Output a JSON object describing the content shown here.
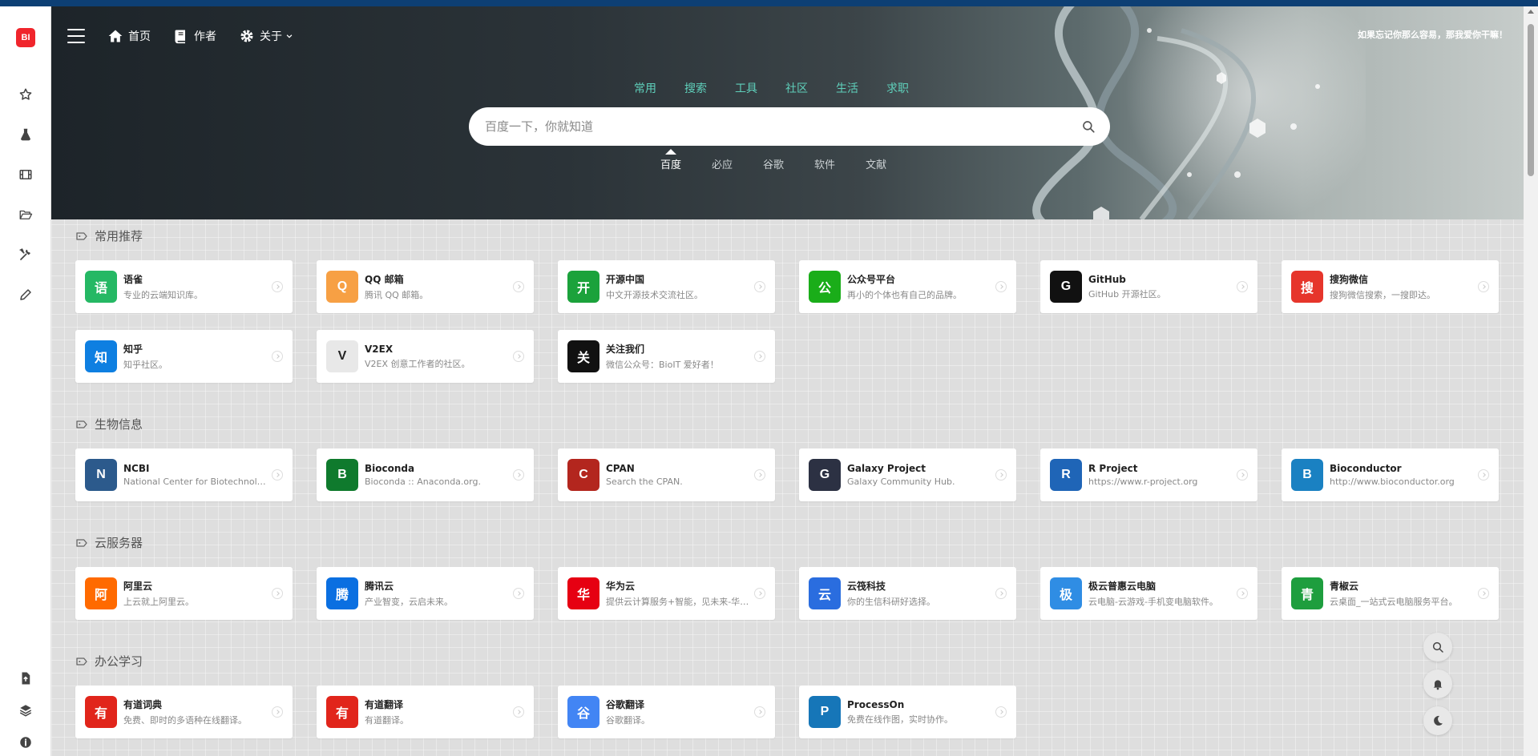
{
  "logo": {
    "text": "BI"
  },
  "nav": {
    "home": "首页",
    "author": "作者",
    "about": "关于"
  },
  "hero": {
    "quote": "如果忘记你那么容易，那我爱你干嘛！"
  },
  "categories": [
    "常用",
    "搜索",
    "工具",
    "社区",
    "生活",
    "求职"
  ],
  "search": {
    "placeholder": "百度一下，你就知道"
  },
  "engines": [
    "百度",
    "必应",
    "谷歌",
    "软件",
    "文献"
  ],
  "sections": [
    {
      "title": "常用推荐",
      "cards": [
        {
          "name": "语雀",
          "desc": "专业的云端知识库。",
          "icon": "yuque-logo",
          "color": "#25b864"
        },
        {
          "name": "QQ 邮箱",
          "desc": "腾讯 QQ 邮箱。",
          "icon": "qqmail-logo",
          "color": "#f7a044"
        },
        {
          "name": "开源中国",
          "desc": "中文开源技术交流社区。",
          "icon": "oschina-logo",
          "color": "#1ba23b"
        },
        {
          "name": "公众号平台",
          "desc": "再小的个体也有自己的品牌。",
          "icon": "wechat-logo",
          "color": "#1aad19"
        },
        {
          "name": "GitHub",
          "desc": "GitHub 开源社区。",
          "icon": "github-logo",
          "color": "#111111"
        },
        {
          "name": "搜狗微信",
          "desc": "搜狗微信搜索，一搜即达。",
          "icon": "sogou-logo",
          "color": "#e6352b"
        },
        {
          "name": "知乎",
          "desc": "知乎社区。",
          "icon": "zhihu-logo",
          "color": "#0e7fe1"
        },
        {
          "name": "V2EX",
          "desc": "V2EX 创意工作者的社区。",
          "icon": "v2ex-logo",
          "color": "#e8e8e8"
        },
        {
          "name": "关注我们",
          "desc": "微信公众号：BioIT 爱好者！",
          "icon": "qrcode-logo",
          "color": "#111111"
        }
      ]
    },
    {
      "title": "生物信息",
      "cards": [
        {
          "name": "NCBI",
          "desc": "National Center for Biotechnology Information",
          "icon": "ncbi-logo",
          "color": "#2c5a8c"
        },
        {
          "name": "Bioconda",
          "desc": "Bioconda :: Anaconda.org.",
          "icon": "bioconda-logo",
          "color": "#0f7a2d"
        },
        {
          "name": "CPAN",
          "desc": "Search the CPAN.",
          "icon": "cpan-logo",
          "color": "#b3261e"
        },
        {
          "name": "Galaxy Project",
          "desc": "Galaxy Community Hub.",
          "icon": "galaxy-logo",
          "color": "#2c3143"
        },
        {
          "name": "R Project",
          "desc": "https://www.r-project.org",
          "icon": "r-logo",
          "color": "#1f65b7"
        },
        {
          "name": "Bioconductor",
          "desc": "http://www.bioconductor.org",
          "icon": "bioconductor-logo",
          "color": "#1a81c2"
        }
      ]
    },
    {
      "title": "云服务器",
      "cards": [
        {
          "name": "阿里云",
          "desc": "上云就上阿里云。",
          "icon": "aliyun-logo",
          "color": "#ff6a00"
        },
        {
          "name": "腾讯云",
          "desc": "产业智变，云启未来。",
          "icon": "tencentcloud-logo",
          "color": "#0a6fe1"
        },
        {
          "name": "华为云",
          "desc": "提供云计算服务+智能，见未来-华为云。",
          "icon": "huawei-logo",
          "color": "#e60012"
        },
        {
          "name": "云筏科技",
          "desc": "你的生信科研好选择。",
          "icon": "yunfa-logo",
          "color": "#2a6ddf"
        },
        {
          "name": "极云普惠云电脑",
          "desc": "云电脑-云游戏-手机变电脑软件。",
          "icon": "jiyun-logo",
          "color": "#2f8de4"
        },
        {
          "name": "青椒云",
          "desc": "云桌面_一站式云电脑服务平台。",
          "icon": "qingjiao-logo",
          "color": "#1e9e3e"
        }
      ]
    },
    {
      "title": "办公学习",
      "cards": [
        {
          "name": "有道词典",
          "desc": "免费、即时的多语种在线翻译。",
          "icon": "youdao-dict-logo",
          "color": "#e1251b"
        },
        {
          "name": "有道翻译",
          "desc": "有道翻译。",
          "icon": "youdao-translate-logo",
          "color": "#e1251b"
        },
        {
          "name": "谷歌翻译",
          "desc": "谷歌翻译。",
          "icon": "google-translate-logo",
          "color": "#4285f4"
        },
        {
          "name": "ProcessOn",
          "desc": "免费在线作图，实时协作。",
          "icon": "processon-logo",
          "color": "#1676b8"
        }
      ]
    }
  ]
}
